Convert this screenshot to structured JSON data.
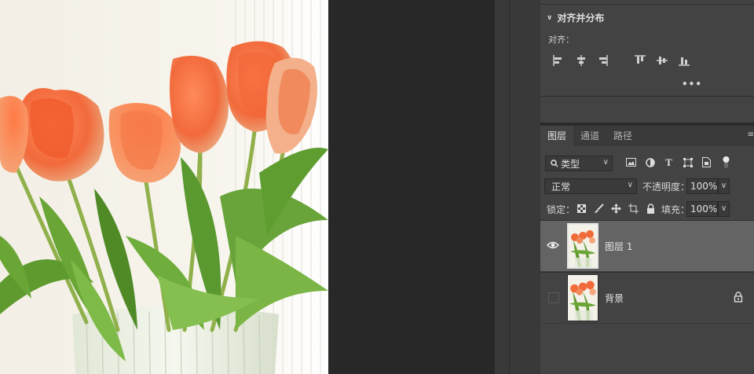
{
  "align_panel": {
    "header": "对齐并分布",
    "align_label": "对齐：",
    "more": "•••",
    "icons": [
      "align-left-edges-icon",
      "align-horizontal-centers-icon",
      "align-right-edges-icon",
      "align-top-edges-icon",
      "align-vertical-centers-icon",
      "align-bottom-edges-icon"
    ]
  },
  "layers_panel": {
    "tabs": [
      {
        "label": "图层",
        "active": true
      },
      {
        "label": "通道",
        "active": false
      },
      {
        "label": "路径",
        "active": false
      }
    ],
    "kind_filter": "类型",
    "blend_mode": "正常",
    "opacity_label": "不透明度：",
    "opacity_value": "100%",
    "lock_label": "锁定：",
    "fill_label": "填充：",
    "fill_value": "100%",
    "layers": [
      {
        "name": "图层 1",
        "visible": true,
        "selected": true,
        "locked": false
      },
      {
        "name": "背景",
        "visible": false,
        "selected": false,
        "locked": true
      }
    ]
  },
  "colors": {
    "panel_bg": "#434343",
    "selected_layer": "#646464",
    "pasteboard": "#282828",
    "tulip_orange": "#f06a3a",
    "leaf_green": "#5e9a2e"
  }
}
